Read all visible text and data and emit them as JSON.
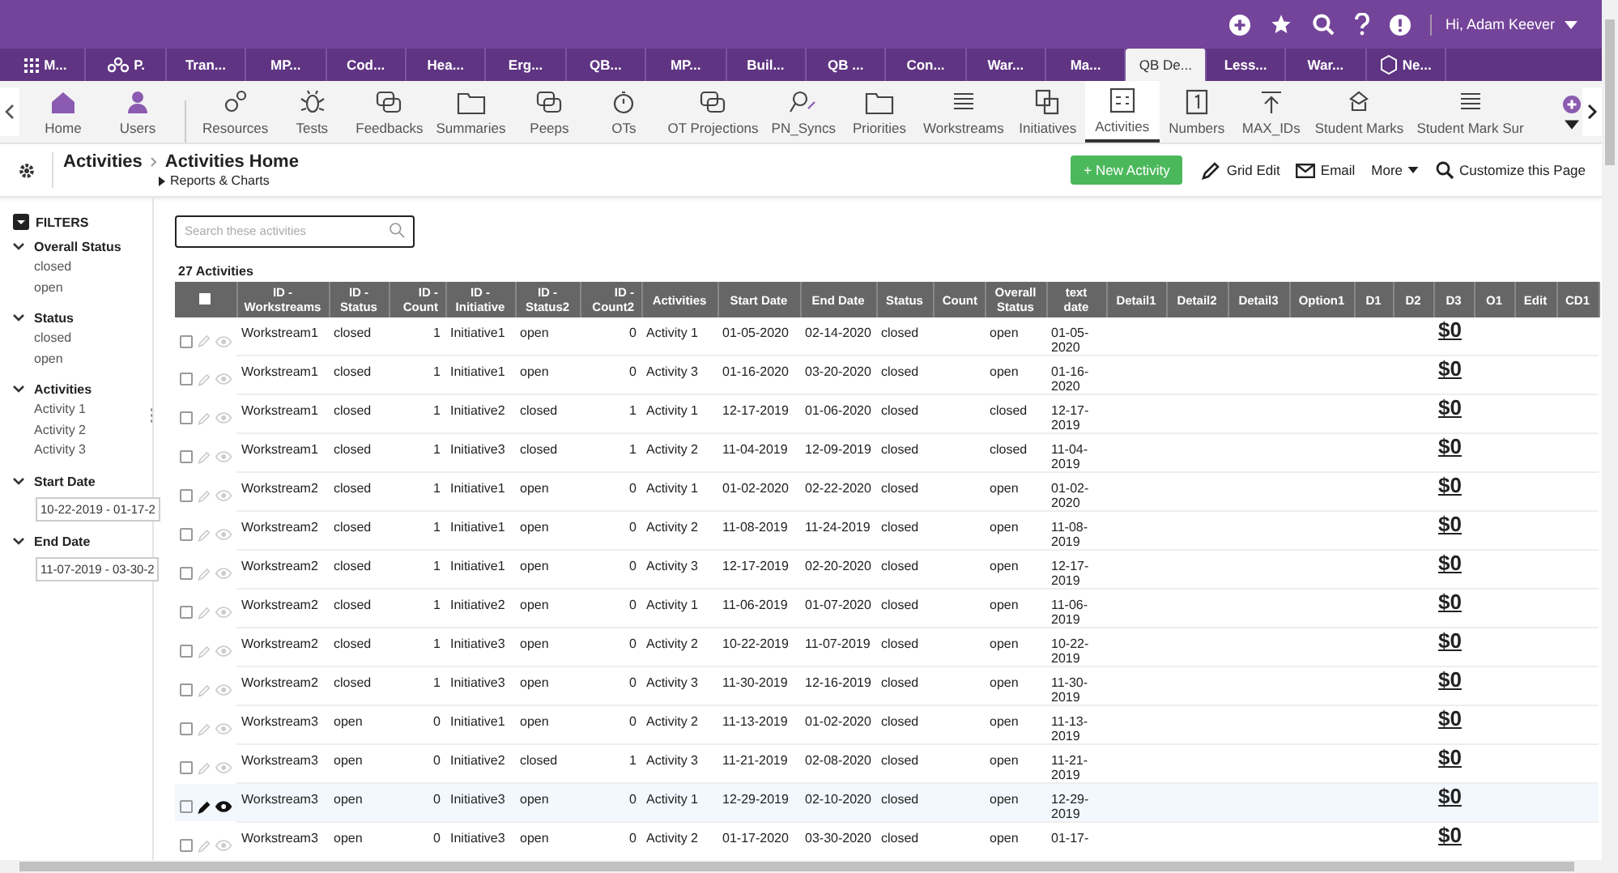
{
  "top_bar": {
    "greeting": "Hi, Adam Keever"
  },
  "app_tabs": [
    {
      "label": "M...",
      "selected": false
    },
    {
      "label": "P.",
      "selected": false
    },
    {
      "label": "Tran...",
      "selected": false
    },
    {
      "label": "MP...",
      "selected": false
    },
    {
      "label": "Cod...",
      "selected": false
    },
    {
      "label": "Hea...",
      "selected": false
    },
    {
      "label": "Erg...",
      "selected": false
    },
    {
      "label": "QB...",
      "selected": false
    },
    {
      "label": "MP...",
      "selected": false
    },
    {
      "label": "Buil...",
      "selected": false
    },
    {
      "label": "QB ...",
      "selected": false
    },
    {
      "label": "Con...",
      "selected": false
    },
    {
      "label": "War...",
      "selected": false
    },
    {
      "label": "Ma...",
      "selected": false
    },
    {
      "label": "QB De...",
      "selected": true
    },
    {
      "label": "Less...",
      "selected": false
    },
    {
      "label": "War...",
      "selected": false
    },
    {
      "label": "Ne...",
      "selected": false
    }
  ],
  "toolbar": [
    {
      "label": "Home",
      "selected": false
    },
    {
      "label": "Users",
      "selected": false
    },
    {
      "label": "Resources",
      "selected": false
    },
    {
      "label": "Tests",
      "selected": false
    },
    {
      "label": "Feedbacks",
      "selected": false
    },
    {
      "label": "Summaries",
      "selected": false
    },
    {
      "label": "Peeps",
      "selected": false
    },
    {
      "label": "OTs",
      "selected": false
    },
    {
      "label": "OT Projections",
      "selected": false
    },
    {
      "label": "PN_Syncs",
      "selected": false
    },
    {
      "label": "Priorities",
      "selected": false
    },
    {
      "label": "Workstreams",
      "selected": false
    },
    {
      "label": "Initiatives",
      "selected": false
    },
    {
      "label": "Activities",
      "selected": true
    },
    {
      "label": "Numbers",
      "selected": false
    },
    {
      "label": "MAX_IDs",
      "selected": false
    },
    {
      "label": "Student Marks",
      "selected": false
    },
    {
      "label": "Student Mark Sur",
      "selected": false
    }
  ],
  "page_header": {
    "breadcrumb": "Activities",
    "title": "Activities Home",
    "sub_link": "Reports & Charts",
    "actions": [
      {
        "label": "+ New Activity",
        "kind": "primary"
      },
      {
        "label": "Grid Edit",
        "kind": "edit"
      },
      {
        "label": "Email",
        "kind": "email"
      },
      {
        "label": "More",
        "kind": "more"
      },
      {
        "label": "Customize this Page",
        "kind": "customize"
      }
    ]
  },
  "filters": {
    "title": "FILTERS",
    "groups": [
      {
        "title": "Overall Status",
        "expanded": true,
        "kind": "list",
        "options": [
          "closed",
          "open"
        ]
      },
      {
        "title": "Status",
        "expanded": true,
        "kind": "list",
        "options": [
          "closed",
          "open"
        ]
      },
      {
        "title": "Activities",
        "expanded": true,
        "kind": "list",
        "options": [
          "Activity 1",
          "Activity 2",
          "Activity 3"
        ]
      },
      {
        "title": "Start Date",
        "expanded": true,
        "kind": "date",
        "value": "10-22-2019 - 01-17-2"
      },
      {
        "title": "End Date",
        "expanded": true,
        "kind": "date",
        "value": "11-07-2019 - 03-30-2"
      }
    ]
  },
  "search": {
    "placeholder": "Search these activities"
  },
  "count_label": "27 Activities",
  "table": {
    "select_all_checked": false,
    "columns": [
      {
        "label": "ID - Workstreams",
        "kind": "text"
      },
      {
        "label": "ID - Status",
        "kind": "text"
      },
      {
        "label": "ID - Count",
        "kind": "number"
      },
      {
        "label": "ID - Initiative",
        "kind": "text"
      },
      {
        "label": "ID - Status2",
        "kind": "text"
      },
      {
        "label": "ID - Count2",
        "kind": "number"
      },
      {
        "label": "Activities",
        "kind": "text"
      },
      {
        "label": "Start Date",
        "kind": "text"
      },
      {
        "label": "End Date",
        "kind": "text"
      },
      {
        "label": "Status",
        "kind": "text"
      },
      {
        "label": "Count",
        "kind": "number"
      },
      {
        "label": "Overall Status",
        "kind": "text"
      },
      {
        "label": "text date",
        "kind": "text"
      },
      {
        "label": "Detail1",
        "kind": "empty"
      },
      {
        "label": "Detail2",
        "kind": "empty"
      },
      {
        "label": "Detail3",
        "kind": "empty"
      },
      {
        "label": "Option1",
        "kind": "empty"
      },
      {
        "label": "D1",
        "kind": "empty"
      },
      {
        "label": "D2",
        "kind": "empty"
      },
      {
        "label": "D3",
        "kind": "money"
      },
      {
        "label": "O1",
        "kind": "empty"
      },
      {
        "label": "Edit",
        "kind": "empty"
      },
      {
        "label": "CD1",
        "kind": "empty"
      }
    ],
    "rows": [
      {
        "checked": false,
        "hovered": false,
        "cells": [
          "Workstream1",
          "closed",
          "1",
          "Initiative1",
          "open",
          "0",
          "Activity 1",
          "01-05-2020",
          "02-14-2020",
          "closed",
          "",
          "open",
          "01-05-2020"
        ],
        "amount": "$0"
      },
      {
        "checked": false,
        "hovered": false,
        "cells": [
          "Workstream1",
          "closed",
          "1",
          "Initiative1",
          "open",
          "0",
          "Activity 3",
          "01-16-2020",
          "03-20-2020",
          "closed",
          "",
          "open",
          "01-16-2020"
        ],
        "amount": "$0"
      },
      {
        "checked": false,
        "hovered": false,
        "cells": [
          "Workstream1",
          "closed",
          "1",
          "Initiative2",
          "closed",
          "1",
          "Activity 1",
          "12-17-2019",
          "01-06-2020",
          "closed",
          "",
          "closed",
          "12-17-2019"
        ],
        "amount": "$0"
      },
      {
        "checked": false,
        "hovered": false,
        "cells": [
          "Workstream1",
          "closed",
          "1",
          "Initiative3",
          "closed",
          "1",
          "Activity 2",
          "11-04-2019",
          "12-09-2019",
          "closed",
          "",
          "closed",
          "11-04-2019"
        ],
        "amount": "$0"
      },
      {
        "checked": false,
        "hovered": false,
        "cells": [
          "Workstream2",
          "closed",
          "1",
          "Initiative1",
          "open",
          "0",
          "Activity 1",
          "01-02-2020",
          "02-22-2020",
          "closed",
          "",
          "open",
          "01-02-2020"
        ],
        "amount": "$0"
      },
      {
        "checked": false,
        "hovered": false,
        "cells": [
          "Workstream2",
          "closed",
          "1",
          "Initiative1",
          "open",
          "0",
          "Activity 2",
          "11-08-2019",
          "11-24-2019",
          "closed",
          "",
          "open",
          "11-08-2019"
        ],
        "amount": "$0"
      },
      {
        "checked": false,
        "hovered": false,
        "cells": [
          "Workstream2",
          "closed",
          "1",
          "Initiative1",
          "open",
          "0",
          "Activity 3",
          "12-17-2019",
          "02-20-2020",
          "closed",
          "",
          "open",
          "12-17-2019"
        ],
        "amount": "$0"
      },
      {
        "checked": false,
        "hovered": false,
        "cells": [
          "Workstream2",
          "closed",
          "1",
          "Initiative2",
          "open",
          "0",
          "Activity 1",
          "11-06-2019",
          "01-07-2020",
          "closed",
          "",
          "open",
          "11-06-2019"
        ],
        "amount": "$0"
      },
      {
        "checked": false,
        "hovered": false,
        "cells": [
          "Workstream2",
          "closed",
          "1",
          "Initiative3",
          "open",
          "0",
          "Activity 2",
          "10-22-2019",
          "11-07-2019",
          "closed",
          "",
          "open",
          "10-22-2019"
        ],
        "amount": "$0"
      },
      {
        "checked": false,
        "hovered": false,
        "cells": [
          "Workstream2",
          "closed",
          "1",
          "Initiative3",
          "open",
          "0",
          "Activity 3",
          "11-30-2019",
          "12-16-2019",
          "closed",
          "",
          "open",
          "11-30-2019"
        ],
        "amount": "$0"
      },
      {
        "checked": false,
        "hovered": false,
        "cells": [
          "Workstream3",
          "open",
          "0",
          "Initiative1",
          "open",
          "0",
          "Activity 2",
          "11-13-2019",
          "01-02-2020",
          "closed",
          "",
          "open",
          "11-13-2019"
        ],
        "amount": "$0"
      },
      {
        "checked": false,
        "hovered": false,
        "cells": [
          "Workstream3",
          "open",
          "0",
          "Initiative2",
          "closed",
          "1",
          "Activity 3",
          "11-21-2019",
          "02-08-2020",
          "closed",
          "",
          "open",
          "11-21-2019"
        ],
        "amount": "$0"
      },
      {
        "checked": false,
        "hovered": true,
        "cells": [
          "Workstream3",
          "open",
          "0",
          "Initiative3",
          "open",
          "0",
          "Activity 1",
          "12-29-2019",
          "02-10-2020",
          "closed",
          "",
          "open",
          "12-29-2019"
        ],
        "amount": "$0"
      },
      {
        "checked": false,
        "hovered": false,
        "cells": [
          "Workstream3",
          "open",
          "0",
          "Initiative3",
          "open",
          "0",
          "Activity 2",
          "01-17-2020",
          "03-30-2020",
          "closed",
          "",
          "open",
          "01-17-"
        ],
        "amount": "$0"
      }
    ]
  }
}
